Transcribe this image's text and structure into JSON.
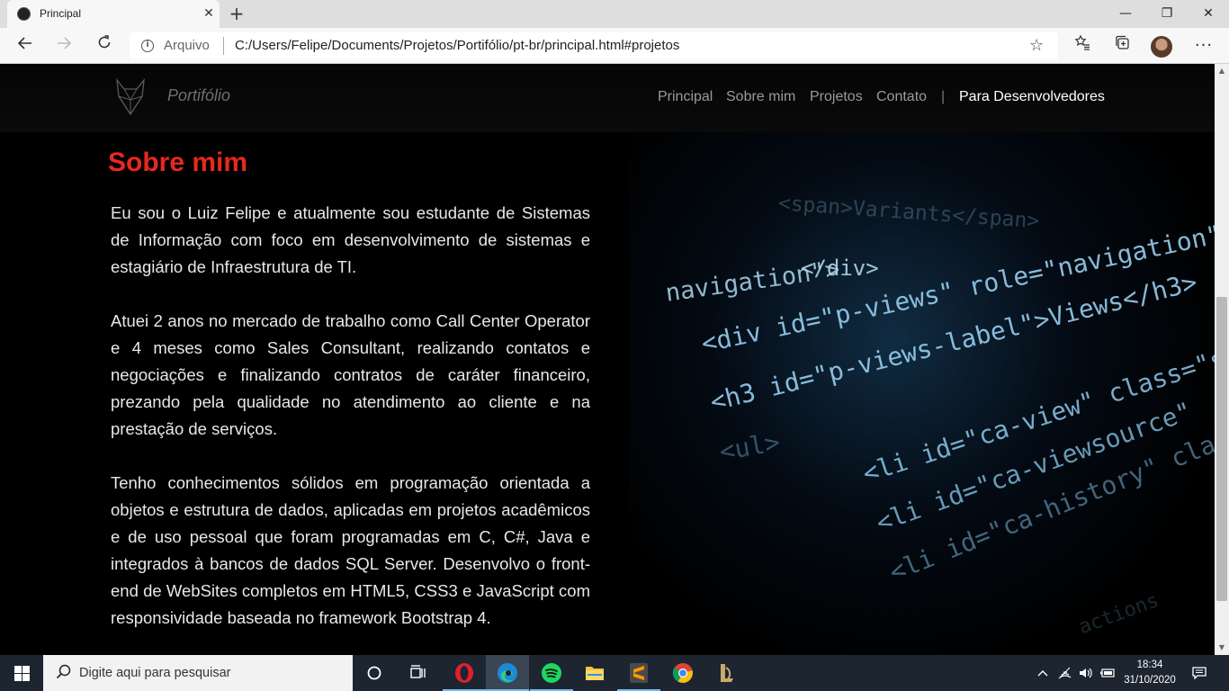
{
  "browser": {
    "tab_title": "Principal",
    "tab_close": "✕",
    "new_tab": "+",
    "window_controls": {
      "minimize": "—",
      "maximize": "❐",
      "close": "✕"
    },
    "address": {
      "scheme_label": "Arquivo",
      "url": "C:/Users/Felipe/Documents/Projetos/Portifólio/pt-br/principal.html#projetos"
    },
    "icons": [
      "back-icon",
      "forward-icon",
      "reload-icon",
      "info-icon",
      "star-icon",
      "favorites-icon",
      "collections-icon",
      "profile-avatar",
      "more-icon"
    ]
  },
  "site": {
    "brand": "Portifólio",
    "nav": {
      "principal": "Principal",
      "sobre": "Sobre mim",
      "projetos": "Projetos",
      "contato": "Contato",
      "divider": "|",
      "dev": "Para Desenvolvedores"
    },
    "section_title": "Sobre mim",
    "paragraphs": [
      "Eu sou o Luiz Felipe e atualmente sou estudante de Sistemas de Informação com foco em desenvolvimento de sistemas e estagiário de Infraestrutura de TI.",
      "Atuei 2 anos no mercado de trabalho como Call Center Operator e 4 meses como Sales Consultant, realizando contatos e negociações e finalizando contratos de caráter financeiro, prezando pela qualidade no atendimento ao cliente e na prestação de serviços.",
      "Tenho conhecimentos sólidos em programação orientada a objetos e estrutura de dados, aplicadas em projetos acadêmicos e de uso pessoal que foram programadas em C, C#, Java e integrados à bancos de dados SQL Server. Desenvolvo o front-end de WebSites completos em HTML5, CSS3 e JavaScript com responsividade baseada no framework Bootstrap 4."
    ],
    "background_code": [
      "<span>Variants</span>",
      "</div>",
      "navigation\">",
      "<div id=\"p-views\" role=\"navigation\"",
      "<h3 id=\"p-views-label\">Views</h3>",
      "<ul>",
      "<li id=\"ca-view\" class=\"selected\"",
      "<li id=\"ca-viewsource\"",
      "<li id=\"ca-history\" class=\"",
      "actions"
    ],
    "colors": {
      "accent": "#e8281f",
      "code": "#9fd4f2",
      "background": "#000000"
    }
  },
  "taskbar": {
    "search_placeholder": "Digite aqui para pesquisar",
    "apps": [
      "cortana-icon",
      "task-view-icon",
      "opera-icon",
      "edge-icon",
      "spotify-icon",
      "file-explorer-icon",
      "sublime-text-icon",
      "chrome-icon",
      "league-of-legends-icon"
    ],
    "time": "18:34",
    "date": "31/10/2020"
  }
}
